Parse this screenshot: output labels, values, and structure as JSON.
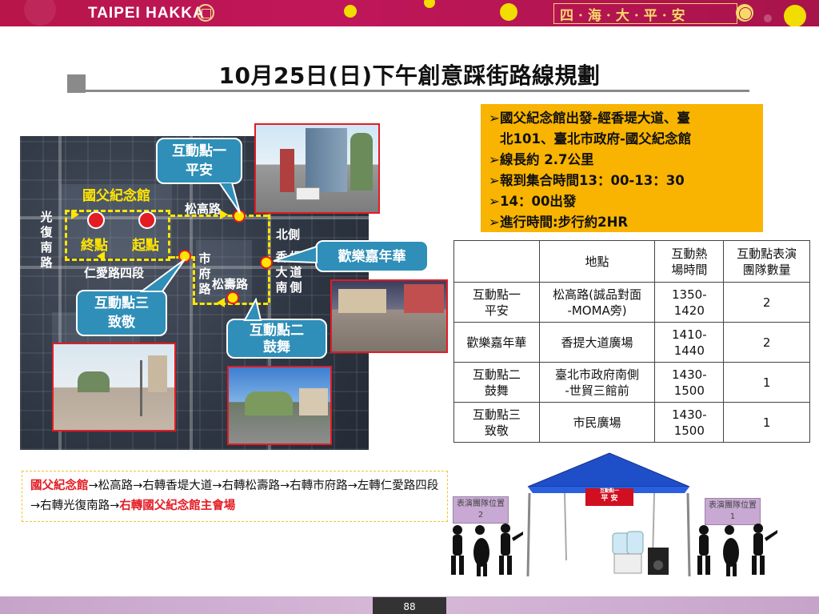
{
  "header": {
    "brand": "TAIPEI HAKKA",
    "slogan": "四·海·大·平·安"
  },
  "title": "10月25日(日)下午創意踩街路線規劃",
  "map": {
    "labels": {
      "memorial": "國父紀念館",
      "songgao": "松高路",
      "guangfu": [
        "光",
        "復",
        "南",
        "路"
      ],
      "end": "終點",
      "start": "起點",
      "renai": "仁愛路四段",
      "shifu": [
        "市",
        "府",
        "路"
      ],
      "songshou": "松壽路",
      "beice": "北側",
      "xiangti": [
        "香",
        "提",
        "大",
        "道",
        "南",
        "側"
      ]
    },
    "callouts": {
      "point1": [
        "互動點一",
        "平安"
      ],
      "carnival": "歡樂嘉年華",
      "point3": [
        "互動點三",
        "致敬"
      ],
      "point2": [
        "互動點二",
        "鼓舞"
      ]
    }
  },
  "info": [
    "國父紀念館出發-經香堤大道、臺",
    "北101、臺北市政府-國父紀念館",
    "線長約 2.7公里",
    "報到集合時間13：00-13：30",
    "14：00出發",
    "進行時間:步行約2HR"
  ],
  "table": {
    "headers": [
      "",
      "地點",
      "互動熱\n場時間",
      "互動點表演\n團隊數量"
    ],
    "rows": [
      [
        "互動點一\n平安",
        "松高路(誠品對面\n-MOMA旁)",
        "1350-\n1420",
        "2"
      ],
      [
        "歡樂嘉年華",
        "香提大道廣場",
        "1410-\n1440",
        "2"
      ],
      [
        "互動點二\n鼓舞",
        "臺北市政府南側\n-世貿三館前",
        "1430-\n1500",
        "1"
      ],
      [
        "互動點三\n致敬",
        "市民廣場",
        "1430-\n1500",
        "1"
      ]
    ]
  },
  "route": {
    "start_red": "國父紀念館",
    "middle": "→松高路→右轉香堤大道→右轉松壽路→右轉市府路→左轉仁愛路四段→右轉光復南路→",
    "end_red": "右轉國父紀念館主會場"
  },
  "tent": {
    "left_sign": [
      "表演團隊位置",
      "2"
    ],
    "right_sign": [
      "表演團隊位置",
      "1"
    ],
    "banner": "平 安",
    "banner_top": "互動點一"
  },
  "footer": {
    "page": "88"
  },
  "colors": {
    "header": "#b8154a",
    "callout": "#2f8fb8",
    "info_box": "#f8b400",
    "route_red": "#e31b23",
    "route_yellow": "#ffe600",
    "tent_blue": "#1f4fc8"
  }
}
